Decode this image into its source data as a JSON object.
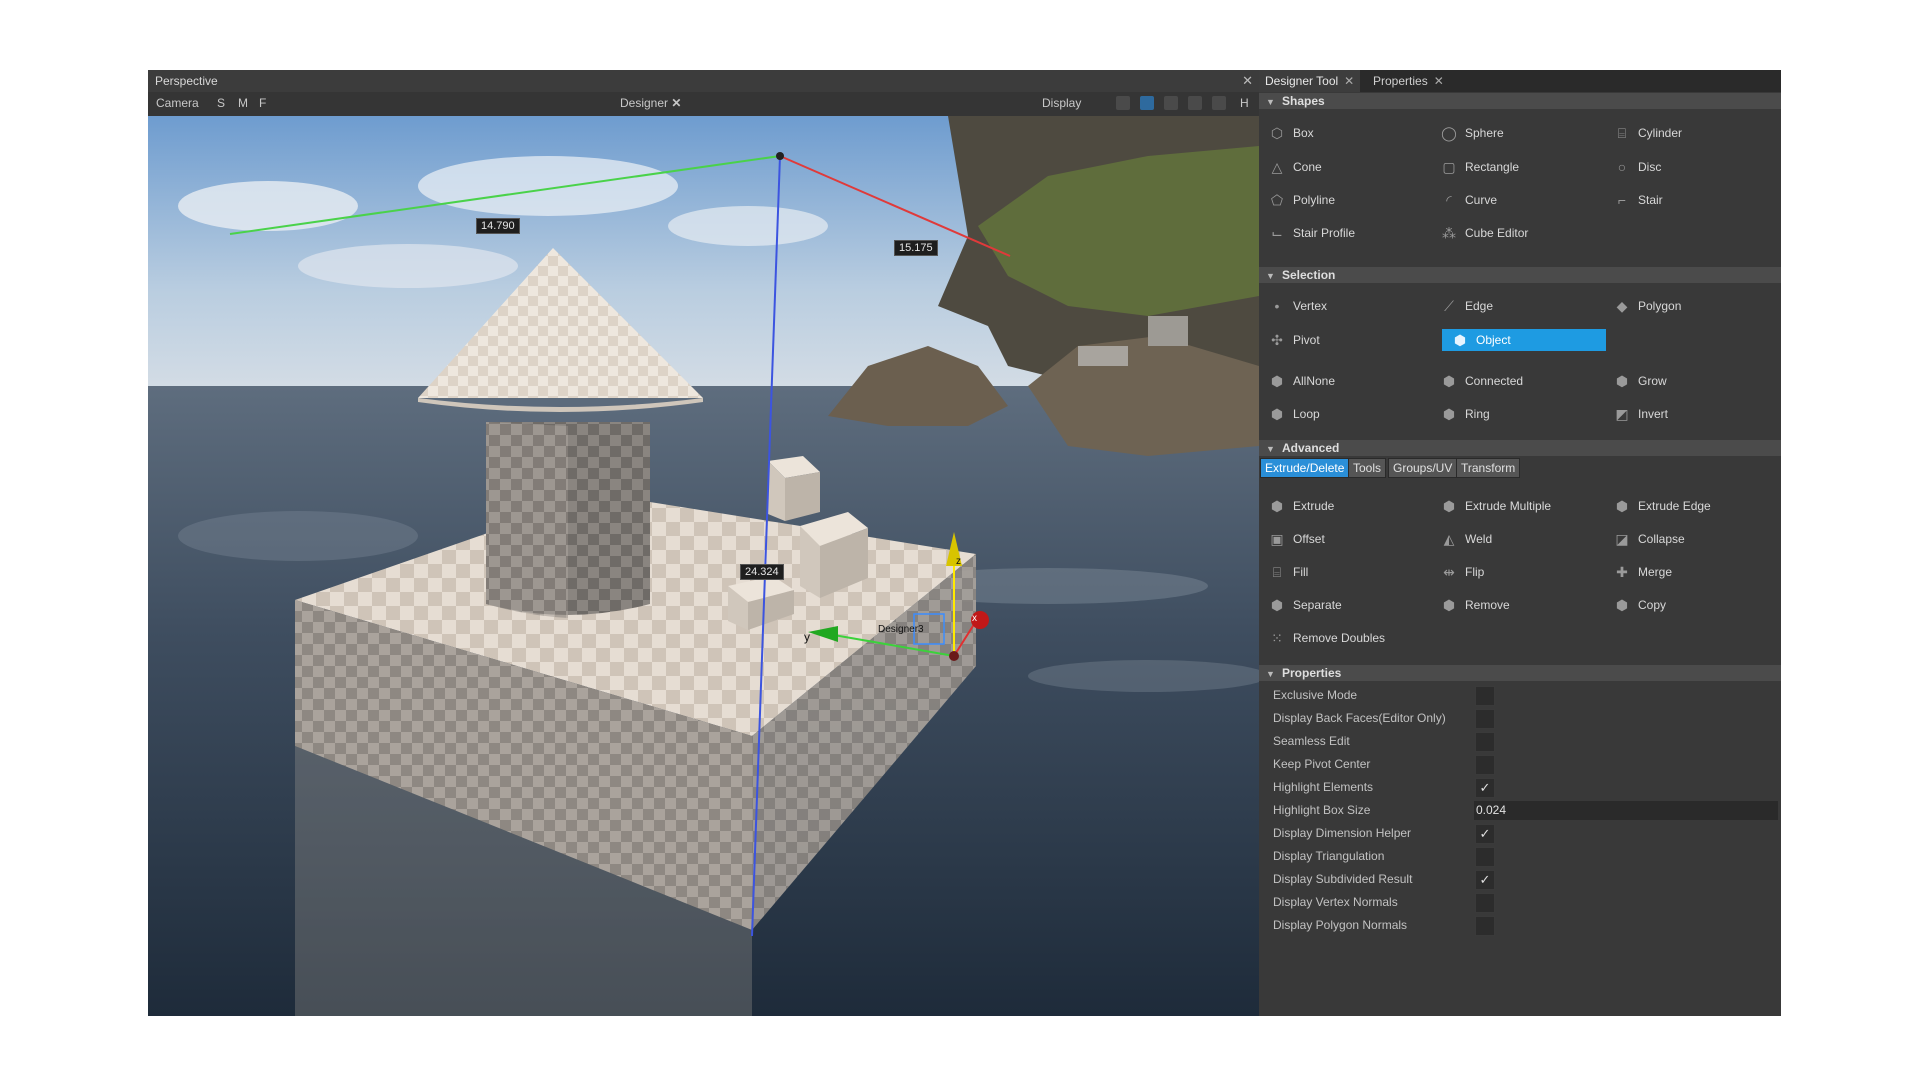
{
  "viewport": {
    "title": "Perspective",
    "toolbar": {
      "camera": "Camera",
      "s": "S",
      "m": "M",
      "f": "F",
      "designer": "Designer",
      "display": "Display",
      "h": "H"
    },
    "measurements": {
      "top_left": "14.790",
      "top_right": "15.175",
      "height": "24.324"
    },
    "gizmo": {
      "x": "x",
      "y": "y",
      "z": "z",
      "object_label": "Designer3"
    }
  },
  "panel": {
    "tabs": [
      "Designer Tool",
      "Properties"
    ],
    "shapes": {
      "header": "Shapes",
      "items": [
        {
          "label": "Box",
          "icon": "box-icon"
        },
        {
          "label": "Sphere",
          "icon": "sphere-icon"
        },
        {
          "label": "Cylinder",
          "icon": "cylinder-icon"
        },
        {
          "label": "Cone",
          "icon": "cone-icon"
        },
        {
          "label": "Rectangle",
          "icon": "rectangle-icon"
        },
        {
          "label": "Disc",
          "icon": "disc-icon"
        },
        {
          "label": "Polyline",
          "icon": "polyline-icon"
        },
        {
          "label": "Curve",
          "icon": "curve-icon"
        },
        {
          "label": "Stair",
          "icon": "stair-icon"
        },
        {
          "label": "Stair Profile",
          "icon": "stair-profile-icon"
        },
        {
          "label": "Cube Editor",
          "icon": "cube-editor-icon"
        }
      ]
    },
    "selection": {
      "header": "Selection",
      "items": [
        {
          "label": "Vertex",
          "icon": "vertex-icon"
        },
        {
          "label": "Edge",
          "icon": "edge-icon"
        },
        {
          "label": "Polygon",
          "icon": "polygon-icon"
        },
        {
          "label": "Pivot",
          "icon": "pivot-icon"
        },
        {
          "label": "Object",
          "icon": "object-icon"
        },
        {
          "label": "AllNone",
          "icon": "all-none-icon"
        },
        {
          "label": "Connected",
          "icon": "connected-icon"
        },
        {
          "label": "Grow",
          "icon": "grow-icon"
        },
        {
          "label": "Loop",
          "icon": "loop-icon"
        },
        {
          "label": "Ring",
          "icon": "ring-icon"
        },
        {
          "label": "Invert",
          "icon": "invert-icon"
        }
      ]
    },
    "advanced": {
      "header": "Advanced",
      "subtabs": [
        "Extrude/Delete",
        "Tools",
        "Groups/UV",
        "Transform"
      ],
      "items": [
        {
          "label": "Extrude",
          "icon": "extrude-icon"
        },
        {
          "label": "Extrude Multiple",
          "icon": "extrude-multiple-icon"
        },
        {
          "label": "Extrude Edge",
          "icon": "extrude-edge-icon"
        },
        {
          "label": "Offset",
          "icon": "offset-icon"
        },
        {
          "label": "Weld",
          "icon": "weld-icon"
        },
        {
          "label": "Collapse",
          "icon": "collapse-icon"
        },
        {
          "label": "Fill",
          "icon": "fill-icon"
        },
        {
          "label": "Flip",
          "icon": "flip-icon"
        },
        {
          "label": "Merge",
          "icon": "merge-icon"
        },
        {
          "label": "Separate",
          "icon": "separate-icon"
        },
        {
          "label": "Remove",
          "icon": "remove-icon"
        },
        {
          "label": "Copy",
          "icon": "copy-icon"
        },
        {
          "label": "Remove Doubles",
          "icon": "remove-doubles-icon"
        }
      ]
    },
    "properties": {
      "header": "Properties",
      "items": [
        {
          "label": "Exclusive Mode",
          "checked": false
        },
        {
          "label": "Display Back Faces(Editor Only)",
          "checked": false
        },
        {
          "label": "Seamless Edit",
          "checked": false
        },
        {
          "label": "Keep Pivot Center",
          "checked": false
        },
        {
          "label": "Highlight Elements",
          "checked": true
        },
        {
          "label": "Highlight Box Size",
          "value": "0.024"
        },
        {
          "label": "Display Dimension Helper",
          "checked": true
        },
        {
          "label": "Display Triangulation",
          "checked": false
        },
        {
          "label": "Display Subdivided Result",
          "checked": true
        },
        {
          "label": "Display Vertex Normals",
          "checked": false
        },
        {
          "label": "Display Polygon Normals",
          "checked": false
        }
      ]
    }
  },
  "colors": {
    "accent": "#1e9be2",
    "subtab_active": "#2a8fd8"
  }
}
